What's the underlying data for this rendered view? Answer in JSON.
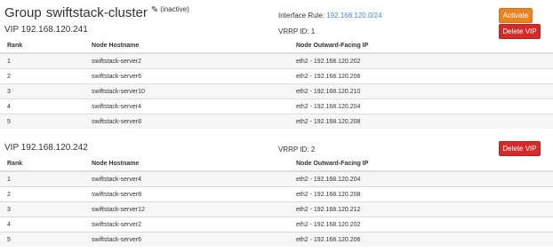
{
  "header": {
    "group_word": "Group",
    "group_name": "swiftstack-cluster",
    "status": "(inactive)",
    "interface_rule_label": "Interface Rule:",
    "interface_rule_value": "192.168.120.0/24",
    "activate_label": "Activate"
  },
  "columns": {
    "rank": "Rank",
    "hostname": "Node Hostname",
    "outward_ip": "Node Outward-Facing IP"
  },
  "vips": [
    {
      "title": "VIP 192.168.120.241",
      "vrrp": "VRRP ID: 1",
      "delete_label": "Delete VIP",
      "rows": [
        {
          "rank": "1",
          "host": "swiftstack-server2",
          "ip": "eth2 - 192.168.120.202"
        },
        {
          "rank": "2",
          "host": "swiftstack-server6",
          "ip": "eth2 - 192.168.120.206"
        },
        {
          "rank": "3",
          "host": "swiftstack-server10",
          "ip": "eth2 - 192.168.120.210"
        },
        {
          "rank": "4",
          "host": "swiftstack-server4",
          "ip": "eth2 - 192.168.120.204"
        },
        {
          "rank": "5",
          "host": "swiftstack-server8",
          "ip": "eth2 - 192.168.120.208"
        }
      ]
    },
    {
      "title": "VIP 192.168.120.242",
      "vrrp": "VRRP ID: 2",
      "delete_label": "Delete VIP",
      "rows": [
        {
          "rank": "1",
          "host": "swiftstack-server4",
          "ip": "eth2 - 192.168.120.204"
        },
        {
          "rank": "2",
          "host": "swiftstack-server8",
          "ip": "eth2 - 192.168.120.208"
        },
        {
          "rank": "3",
          "host": "swiftstack-server12",
          "ip": "eth2 - 192.168.120.212"
        },
        {
          "rank": "4",
          "host": "swiftstack-server2",
          "ip": "eth2 - 192.168.120.202"
        },
        {
          "rank": "5",
          "host": "swiftstack-server6",
          "ip": "eth2 - 192.168.120.206"
        }
      ]
    }
  ],
  "colors": {
    "accent_link": "#428bca",
    "activate": "#ec8321",
    "delete": "#d42b29"
  }
}
